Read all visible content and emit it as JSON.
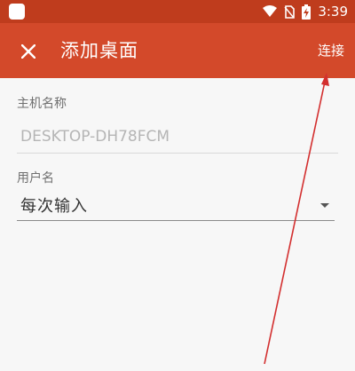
{
  "status_bar": {
    "time": "3:39",
    "icons": [
      "app-square-icon",
      "wifi-icon",
      "no-sim-icon",
      "battery-charging-icon"
    ]
  },
  "app_bar": {
    "close_icon": "close-icon",
    "title": "添加桌面",
    "connect_label": "连接"
  },
  "form": {
    "hostname": {
      "label": "主机名称",
      "placeholder": "DESKTOP-DH78FCM",
      "value": ""
    },
    "username": {
      "label": "用户名",
      "selected": "每次输入"
    }
  },
  "colors": {
    "status_bar": "#bf3c1d",
    "app_bar": "#d3492a",
    "annotation_arrow": "#d32f2f"
  }
}
